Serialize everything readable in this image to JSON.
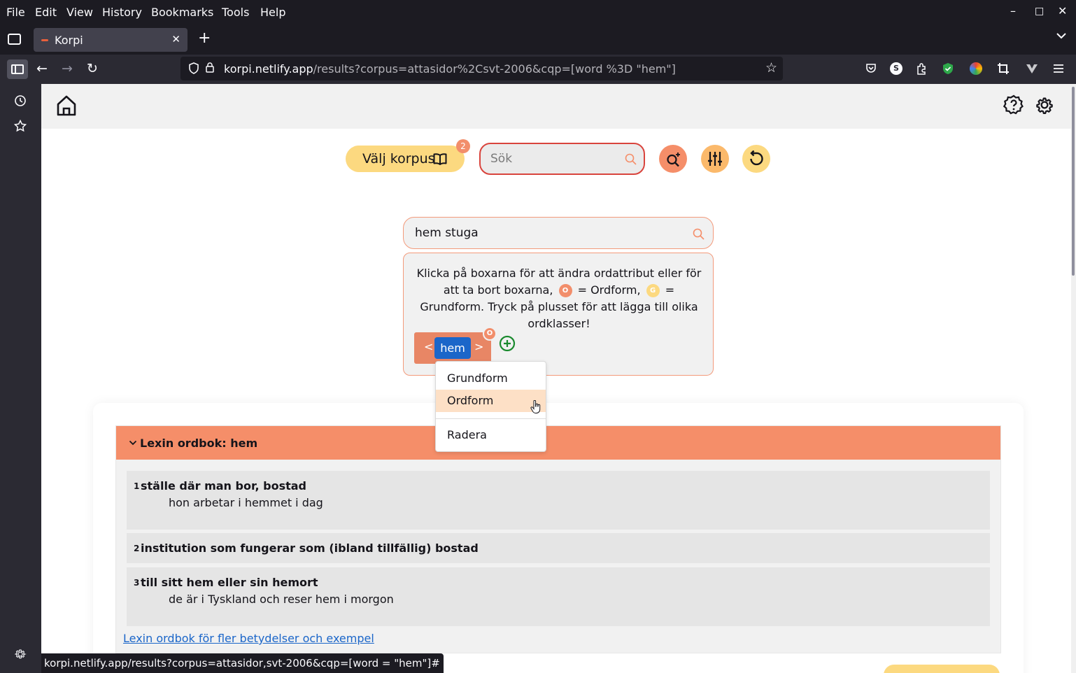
{
  "menu": {
    "file": "File",
    "edit": "Edit",
    "view": "View",
    "history": "History",
    "bookmarks": "Bookmarks",
    "tools": "Tools",
    "help": "Help"
  },
  "window_controls": {
    "minimize": "–",
    "maximize": "□",
    "close": "✕"
  },
  "tab": {
    "title": "Korpi",
    "close": "✕",
    "new_tab": "+",
    "list_all": "⌄"
  },
  "nav": {
    "back": "←",
    "forward": "→",
    "reload": "↻"
  },
  "urlbar": {
    "host": "korpi.netlify.app",
    "path": "/results?corpus=attasidor%2Csvt-2006&cqp=[word %3D \"hem\"]",
    "bookmark_icon": "star-icon"
  },
  "extensions": [
    "pocket-icon",
    "s-extension-icon",
    "extensions-icon",
    "shield-extension-icon",
    "color-extension-icon",
    "crop-icon",
    "v-extension-icon",
    "menu-icon"
  ],
  "sidebar_icons": [
    "history-icon",
    "bookmarks-star-icon",
    "sidebar-settings-icon"
  ],
  "app": {
    "korpus_button": "Välj korpus",
    "korpus_count": "2",
    "search_placeholder": "Sök",
    "query_value": "hem stuga",
    "help_line1": "Klicka på boxarna för att ändra ordattribut eller för att ta bort boxarna,",
    "o_letter": "O",
    "o_meaning": "= Ordform,",
    "g_letter": "G",
    "g_meaning": "= Grundform.",
    "help_line3": "Tryck på plusset för att lägga till olika ordklasser!",
    "token_prev": "<",
    "token_next": ">",
    "token_word": "hem",
    "token_badge": "O",
    "dropdown": {
      "grundform": "Grundform",
      "ordform": "Ordform",
      "radera": "Radera"
    },
    "lexin": {
      "title": "Lexin ordbok: hem",
      "senses": [
        {
          "num": "1",
          "definition": "ställe där man bor, bostad",
          "example": "hon arbetar i hemmet i dag"
        },
        {
          "num": "2",
          "definition": "institution som fungerar som (ibland tillfällig) bostad",
          "example": ""
        },
        {
          "num": "3",
          "definition": "till sitt hem eller sin hemort",
          "example": "de är i Tyskland och reser hem i morgon"
        }
      ],
      "link": "Lexin ordbok för fler betydelser och exempel"
    }
  },
  "status_url": "korpi.netlify.app/results?corpus=attasidor,svt-2006&cqp=[word = \"hem\"]#",
  "colors": {
    "accent_orange": "#f58e69",
    "accent_yellow": "#fcd980",
    "token_blue": "#1b66c9",
    "search_border_red": "#d9443d",
    "add_green": "#1a8a2e"
  }
}
